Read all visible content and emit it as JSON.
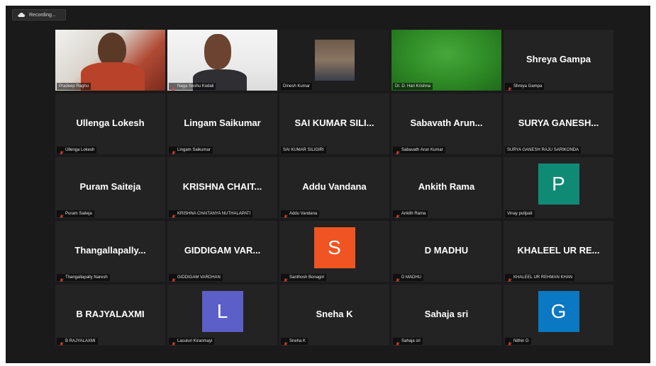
{
  "recording": {
    "label": "Recording..."
  },
  "participants": [
    {
      "tile_name": "",
      "footer": "Pradeep Raghu",
      "video": "camera-warm",
      "muted": false
    },
    {
      "tile_name": "",
      "footer": "Naga Seshu Kodali",
      "video": "camera-light",
      "muted": true
    },
    {
      "tile_name": "",
      "footer": "Dinesh Kumar",
      "video": "camera-dark",
      "muted": false,
      "active": true
    },
    {
      "tile_name": "",
      "footer": "Dr. D. Hari Krishna",
      "video": "camera-green",
      "muted": false
    },
    {
      "tile_name": "Shreya Gampa",
      "footer": "Shreya Gampa",
      "muted": true
    },
    {
      "tile_name": "Ullenga Lokesh",
      "footer": "Ullenga Lokesh",
      "muted": true
    },
    {
      "tile_name": "Lingam Saikumar",
      "footer": "Lingam Saikumar",
      "muted": true
    },
    {
      "tile_name": "SAI KUMAR SILI...",
      "footer": "SAI KUMAR SILIGIRI",
      "muted": false
    },
    {
      "tile_name": "Sabavath Arun...",
      "footer": "Sabavath Arun Kumar",
      "muted": true
    },
    {
      "tile_name": "SURYA GANESH...",
      "footer": "SURYA GANESH RAJU SARIKONDA",
      "muted": false
    },
    {
      "tile_name": "Puram Saiteja",
      "footer": "Puram Saiteja",
      "muted": true
    },
    {
      "tile_name": "KRISHNA CHAIT...",
      "footer": "KRISHNA CHAITANYA NUTHALAPATI",
      "muted": true
    },
    {
      "tile_name": "Addu Vandana",
      "footer": "Addu Vandana",
      "muted": true
    },
    {
      "tile_name": "Ankith Rama",
      "footer": "Ankith Rama",
      "muted": true
    },
    {
      "tile_name": "",
      "footer": "Vinay pulipati",
      "muted": false,
      "avatar": {
        "letter": "P",
        "color": "#0f8b75"
      }
    },
    {
      "tile_name": "Thangallapally...",
      "footer": "Thangallapally Naresh",
      "muted": true
    },
    {
      "tile_name": "GIDDIGAM VAR...",
      "footer": "GIDDIGAM VARDHAN",
      "muted": true
    },
    {
      "tile_name": "",
      "footer": "Santhosh Bonagiri",
      "muted": true,
      "avatar": {
        "letter": "S",
        "color": "#f05422"
      }
    },
    {
      "tile_name": "D MADHU",
      "footer": "D MADHU",
      "muted": true
    },
    {
      "tile_name": "KHALEEL UR RE...",
      "footer": "KHALEEL UR REHMAN KHAN",
      "muted": true
    },
    {
      "tile_name": "B RAJYALAXMI",
      "footer": "B RAJYALAXMI",
      "muted": true
    },
    {
      "tile_name": "",
      "footer": "Lasuluri Kiranmayi",
      "muted": true,
      "avatar": {
        "letter": "L",
        "color": "#5b5fc7"
      }
    },
    {
      "tile_name": "Sneha K",
      "footer": "Sneha K",
      "muted": true
    },
    {
      "tile_name": "Sahaja sri",
      "footer": "Sahaja sri",
      "muted": true
    },
    {
      "tile_name": "",
      "footer": "Nithin G",
      "muted": true,
      "avatar": {
        "letter": "G",
        "color": "#0a78c2"
      }
    }
  ]
}
